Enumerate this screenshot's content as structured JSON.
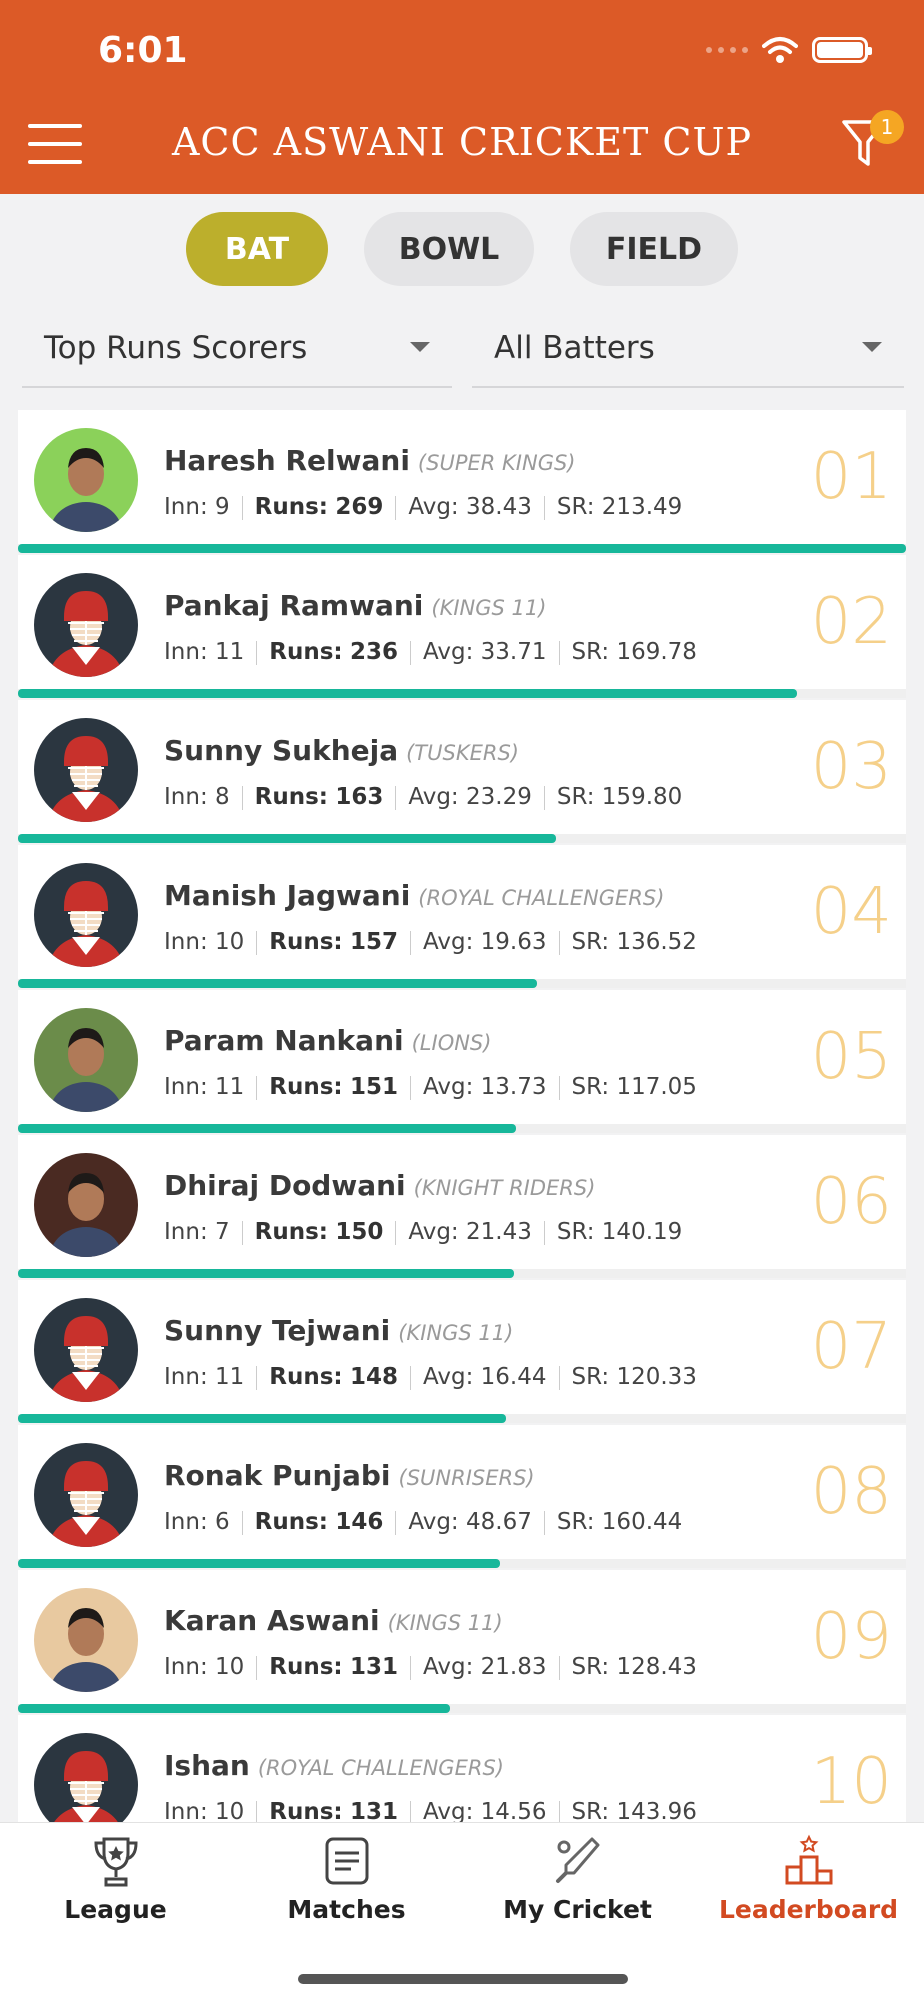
{
  "status_bar": {
    "time": "6:01"
  },
  "header": {
    "title": "ACC ASWANI CRICKET CUP",
    "filter_badge": "1"
  },
  "segments": [
    {
      "label": "BAT",
      "active": true
    },
    {
      "label": "BOWL",
      "active": false
    },
    {
      "label": "FIELD",
      "active": false
    }
  ],
  "filters": {
    "category": "Top Runs Scorers",
    "players": "All Batters"
  },
  "stat_labels": {
    "inn": "Inn:",
    "runs": "Runs:",
    "avg": "Avg:",
    "sr": "SR:"
  },
  "players": [
    {
      "rank": "01",
      "name": "Haresh Relwani",
      "team": "(SUPER KINGS)",
      "inn": "9",
      "runs": "269",
      "avg": "38.43",
      "sr": "213.49",
      "avatar": "photo",
      "bar": 1.0
    },
    {
      "rank": "02",
      "name": "Pankaj Ramwani",
      "team": "(KINGS 11)",
      "inn": "11",
      "runs": "236",
      "avg": "33.71",
      "sr": "169.78",
      "avatar": "helmet",
      "bar": 0.877
    },
    {
      "rank": "03",
      "name": "Sunny Sukheja",
      "team": "(TUSKERS)",
      "inn": "8",
      "runs": "163",
      "avg": "23.29",
      "sr": "159.80",
      "avatar": "helmet",
      "bar": 0.606
    },
    {
      "rank": "04",
      "name": "Manish Jagwani",
      "team": "(ROYAL CHALLENGERS)",
      "inn": "10",
      "runs": "157",
      "avg": "19.63",
      "sr": "136.52",
      "avatar": "helmet",
      "bar": 0.584
    },
    {
      "rank": "05",
      "name": "Param Nankani",
      "team": "(LIONS)",
      "inn": "11",
      "runs": "151",
      "avg": "13.73",
      "sr": "117.05",
      "avatar": "photo",
      "bar": 0.561
    },
    {
      "rank": "06",
      "name": "Dhiraj Dodwani",
      "team": "(KNIGHT RIDERS)",
      "inn": "7",
      "runs": "150",
      "avg": "21.43",
      "sr": "140.19",
      "avatar": "photo",
      "bar": 0.558
    },
    {
      "rank": "07",
      "name": "Sunny Tejwani",
      "team": "(KINGS 11)",
      "inn": "11",
      "runs": "148",
      "avg": "16.44",
      "sr": "120.33",
      "avatar": "helmet",
      "bar": 0.55
    },
    {
      "rank": "08",
      "name": "Ronak Punjabi",
      "team": "(SUNRISERS)",
      "inn": "6",
      "runs": "146",
      "avg": "48.67",
      "sr": "160.44",
      "avatar": "helmet",
      "bar": 0.543
    },
    {
      "rank": "09",
      "name": "Karan Aswani",
      "team": "(KINGS 11)",
      "inn": "10",
      "runs": "131",
      "avg": "21.83",
      "sr": "128.43",
      "avatar": "photo",
      "bar": 0.487
    },
    {
      "rank": "10",
      "name": "Ishan",
      "team": "(ROYAL CHALLENGERS)",
      "inn": "10",
      "runs": "131",
      "avg": "14.56",
      "sr": "143.96",
      "avatar": "helmet",
      "bar": 0.487
    }
  ],
  "tabs": [
    {
      "label": "League",
      "icon": "trophy-icon",
      "active": false
    },
    {
      "label": "Matches",
      "icon": "document-icon",
      "active": false
    },
    {
      "label": "My Cricket",
      "icon": "cricket-bat-icon",
      "active": false
    },
    {
      "label": "Leaderboard",
      "icon": "podium-icon",
      "active": true
    }
  ],
  "colors": {
    "header": "#dc5a27",
    "active_segment": "#bcaf2c",
    "progress": "#17b79a",
    "rank": "#f5d08a",
    "active_tab": "#d24a21"
  }
}
